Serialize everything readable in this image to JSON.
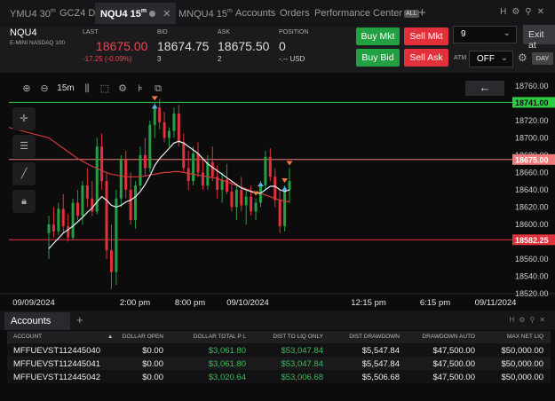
{
  "tabs": [
    {
      "symbol": "YMU4",
      "interval": "30",
      "interval_unit": "m",
      "active": false
    },
    {
      "symbol": "GCZ4",
      "interval": "D",
      "interval_unit": "",
      "active": false
    },
    {
      "symbol": "NQU4",
      "interval": "15",
      "interval_unit": "m",
      "active": true
    },
    {
      "symbol": "MNQU4",
      "interval": "15",
      "interval_unit": "m",
      "active": false
    }
  ],
  "nav": {
    "accounts": "Accounts",
    "orders": "Orders",
    "performance": "Performance Center",
    "all_badge": "ALL"
  },
  "quote": {
    "symbol": "NQU4",
    "description": "E-MINI NASDAQ 100",
    "last_label": "LAST",
    "last": "18675.00",
    "change": "-17.25 (-0.09%)",
    "bid_label": "BID",
    "bid": "18674.75",
    "bid_size": "3",
    "ask_label": "ASK",
    "ask": "18675.50",
    "ask_size": "2",
    "position_label": "POSITION",
    "position": "0",
    "position_sub": "-.-- USD"
  },
  "order_buttons": {
    "buy_mkt": "Buy Mkt",
    "sell_mkt": "Sell Mkt",
    "buy_bid": "Buy Bid",
    "sell_ask": "Sell Ask",
    "exit": "Exit at"
  },
  "quantity": "9",
  "atm_label": "ATM",
  "atm_value": "OFF",
  "day_label": "DAY",
  "chart_toolbar": {
    "timeframe": "15m"
  },
  "colors": {
    "up": "#23a042",
    "down": "#e3313c",
    "ma_red": "#d23a3a",
    "ma_white": "#e9eef5",
    "price_tag": "#f07a7a",
    "green_line": "#2ecc40"
  },
  "chart_data": {
    "type": "candlestick",
    "title": "",
    "y_ticks": [
      "18760.00",
      "18720.00",
      "18700.00",
      "18680.00",
      "18660.00",
      "18640.00",
      "18620.00",
      "18600.00",
      "18560.00",
      "18540.00",
      "18520.00"
    ],
    "ylim": [
      18520,
      18766
    ],
    "x_ticks": [
      "09/09/2024",
      "2:00 pm",
      "8:00 pm",
      "09/10/2024",
      "12:15 pm",
      "6:15 pm",
      "09/11/2024"
    ],
    "price_markers": [
      {
        "label": "18741.00",
        "value": 18741.0,
        "style": "green"
      },
      {
        "label": "18675.00",
        "value": 18675.0,
        "style": "current"
      },
      {
        "label": "18582.25",
        "value": 18582.25,
        "style": "red"
      }
    ],
    "candles": [
      {
        "o": 18590,
        "h": 18610,
        "l": 18560,
        "c": 18600
      },
      {
        "o": 18600,
        "h": 18620,
        "l": 18585,
        "c": 18592
      },
      {
        "o": 18592,
        "h": 18625,
        "l": 18588,
        "c": 18618
      },
      {
        "o": 18618,
        "h": 18635,
        "l": 18590,
        "c": 18598
      },
      {
        "o": 18598,
        "h": 18612,
        "l": 18580,
        "c": 18585
      },
      {
        "o": 18585,
        "h": 18630,
        "l": 18582,
        "c": 18625
      },
      {
        "o": 18625,
        "h": 18640,
        "l": 18605,
        "c": 18610
      },
      {
        "o": 18610,
        "h": 18650,
        "l": 18600,
        "c": 18645
      },
      {
        "o": 18645,
        "h": 18665,
        "l": 18620,
        "c": 18630
      },
      {
        "o": 18630,
        "h": 18650,
        "l": 18610,
        "c": 18615
      },
      {
        "o": 18615,
        "h": 18700,
        "l": 18612,
        "c": 18690
      },
      {
        "o": 18690,
        "h": 18705,
        "l": 18640,
        "c": 18650
      },
      {
        "o": 18650,
        "h": 18660,
        "l": 18560,
        "c": 18570
      },
      {
        "o": 18570,
        "h": 18600,
        "l": 18525,
        "c": 18545
      },
      {
        "o": 18545,
        "h": 18640,
        "l": 18530,
        "c": 18630
      },
      {
        "o": 18630,
        "h": 18680,
        "l": 18620,
        "c": 18675
      },
      {
        "o": 18675,
        "h": 18685,
        "l": 18630,
        "c": 18640
      },
      {
        "o": 18640,
        "h": 18660,
        "l": 18600,
        "c": 18605
      },
      {
        "o": 18605,
        "h": 18650,
        "l": 18595,
        "c": 18645
      },
      {
        "o": 18645,
        "h": 18690,
        "l": 18640,
        "c": 18680
      },
      {
        "o": 18680,
        "h": 18700,
        "l": 18655,
        "c": 18665
      },
      {
        "o": 18665,
        "h": 18720,
        "l": 18660,
        "c": 18715
      },
      {
        "o": 18715,
        "h": 18740,
        "l": 18700,
        "c": 18735
      },
      {
        "o": 18735,
        "h": 18745,
        "l": 18710,
        "c": 18718
      },
      {
        "o": 18718,
        "h": 18730,
        "l": 18695,
        "c": 18700
      },
      {
        "o": 18700,
        "h": 18712,
        "l": 18690,
        "c": 18708
      },
      {
        "o": 18708,
        "h": 18735,
        "l": 18700,
        "c": 18728
      },
      {
        "o": 18728,
        "h": 18738,
        "l": 18690,
        "c": 18695
      },
      {
        "o": 18695,
        "h": 18705,
        "l": 18660,
        "c": 18665
      },
      {
        "o": 18665,
        "h": 18685,
        "l": 18640,
        "c": 18650
      },
      {
        "o": 18650,
        "h": 18690,
        "l": 18645,
        "c": 18682
      },
      {
        "o": 18682,
        "h": 18695,
        "l": 18655,
        "c": 18660
      },
      {
        "o": 18660,
        "h": 18675,
        "l": 18640,
        "c": 18645
      },
      {
        "o": 18645,
        "h": 18680,
        "l": 18640,
        "c": 18672
      },
      {
        "o": 18672,
        "h": 18690,
        "l": 18650,
        "c": 18655
      },
      {
        "o": 18655,
        "h": 18668,
        "l": 18630,
        "c": 18640
      },
      {
        "o": 18640,
        "h": 18660,
        "l": 18625,
        "c": 18652
      },
      {
        "o": 18652,
        "h": 18670,
        "l": 18635,
        "c": 18638
      },
      {
        "o": 18638,
        "h": 18650,
        "l": 18615,
        "c": 18620
      },
      {
        "o": 18620,
        "h": 18645,
        "l": 18605,
        "c": 18640
      },
      {
        "o": 18640,
        "h": 18655,
        "l": 18615,
        "c": 18622
      },
      {
        "o": 18622,
        "h": 18640,
        "l": 18600,
        "c": 18632
      },
      {
        "o": 18632,
        "h": 18645,
        "l": 18610,
        "c": 18615
      },
      {
        "o": 18615,
        "h": 18630,
        "l": 18605,
        "c": 18625
      },
      {
        "o": 18625,
        "h": 18650,
        "l": 18620,
        "c": 18645
      },
      {
        "o": 18645,
        "h": 18685,
        "l": 18640,
        "c": 18678
      },
      {
        "o": 18678,
        "h": 18688,
        "l": 18650,
        "c": 18655
      },
      {
        "o": 18655,
        "h": 18665,
        "l": 18620,
        "c": 18628
      },
      {
        "o": 18628,
        "h": 18640,
        "l": 18590,
        "c": 18598
      },
      {
        "o": 18598,
        "h": 18645,
        "l": 18592,
        "c": 18640
      },
      {
        "o": 18640,
        "h": 18665,
        "l": 18625,
        "c": 18650
      }
    ],
    "ma_red": [
      18700,
      18696,
      18692,
      18688,
      18684,
      18680,
      18676,
      18673,
      18670,
      18667,
      18665,
      18662,
      18660,
      18658,
      18657,
      18656,
      18655,
      18655,
      18655,
      18655,
      18656,
      18657,
      18658,
      18659,
      18660,
      18660,
      18661,
      18661,
      18660,
      18659,
      18658,
      18657,
      18656,
      18655,
      18654,
      18653,
      18651,
      18649,
      18647,
      18645,
      18643,
      18641,
      18639,
      18637,
      18636,
      18634,
      18632,
      18630,
      18628,
      18627,
      18626
    ],
    "ma_white": [
      18572,
      18578,
      18584,
      18590,
      18594,
      18598,
      18603,
      18608,
      18614,
      18619,
      18626,
      18632,
      18628,
      18622,
      18620,
      18622,
      18626,
      18628,
      18632,
      18638,
      18646,
      18656,
      18668,
      18676,
      18682,
      18688,
      18694,
      18696,
      18694,
      18690,
      18686,
      18682,
      18676,
      18670,
      18666,
      18662,
      18658,
      18654,
      18650,
      18646,
      18642,
      18640,
      18638,
      18636,
      18636,
      18640,
      18644,
      18644,
      18640,
      18638,
      18640
    ],
    "order_markers": [
      {
        "index": 22,
        "kind": "sell"
      },
      {
        "index": 22,
        "kind": "buy"
      },
      {
        "index": 43,
        "kind": "sell"
      },
      {
        "index": 44,
        "kind": "buy"
      },
      {
        "index": 49,
        "kind": "sell"
      },
      {
        "index": 49,
        "kind": "buy"
      },
      {
        "index": 50,
        "kind": "sell"
      }
    ]
  },
  "accounts_panel": {
    "tab_label": "Accounts",
    "columns": [
      "ACCOUNT",
      "DOLLAR OPEN",
      "DOLLAR TOTAL P L",
      "DIST TO LIQ ONLY",
      "DIST DRAWDOWN",
      "DRAWDOWN AUTO",
      "MAX NET LIQ"
    ],
    "rows": [
      [
        "MFFUEVST112445040",
        "$0.00",
        "$3,061.80",
        "$53,047.84",
        "$5,547.84",
        "$47,500.00",
        "$50,000.00"
      ],
      [
        "MFFUEVST112445041",
        "$0.00",
        "$3,061.80",
        "$53,047.84",
        "$5,547.84",
        "$47,500.00",
        "$50,000.00"
      ],
      [
        "MFFUEVST112445042",
        "$0.00",
        "$3,020.64",
        "$53,006.68",
        "$5,506.68",
        "$47,500.00",
        "$50,000.00"
      ]
    ]
  }
}
